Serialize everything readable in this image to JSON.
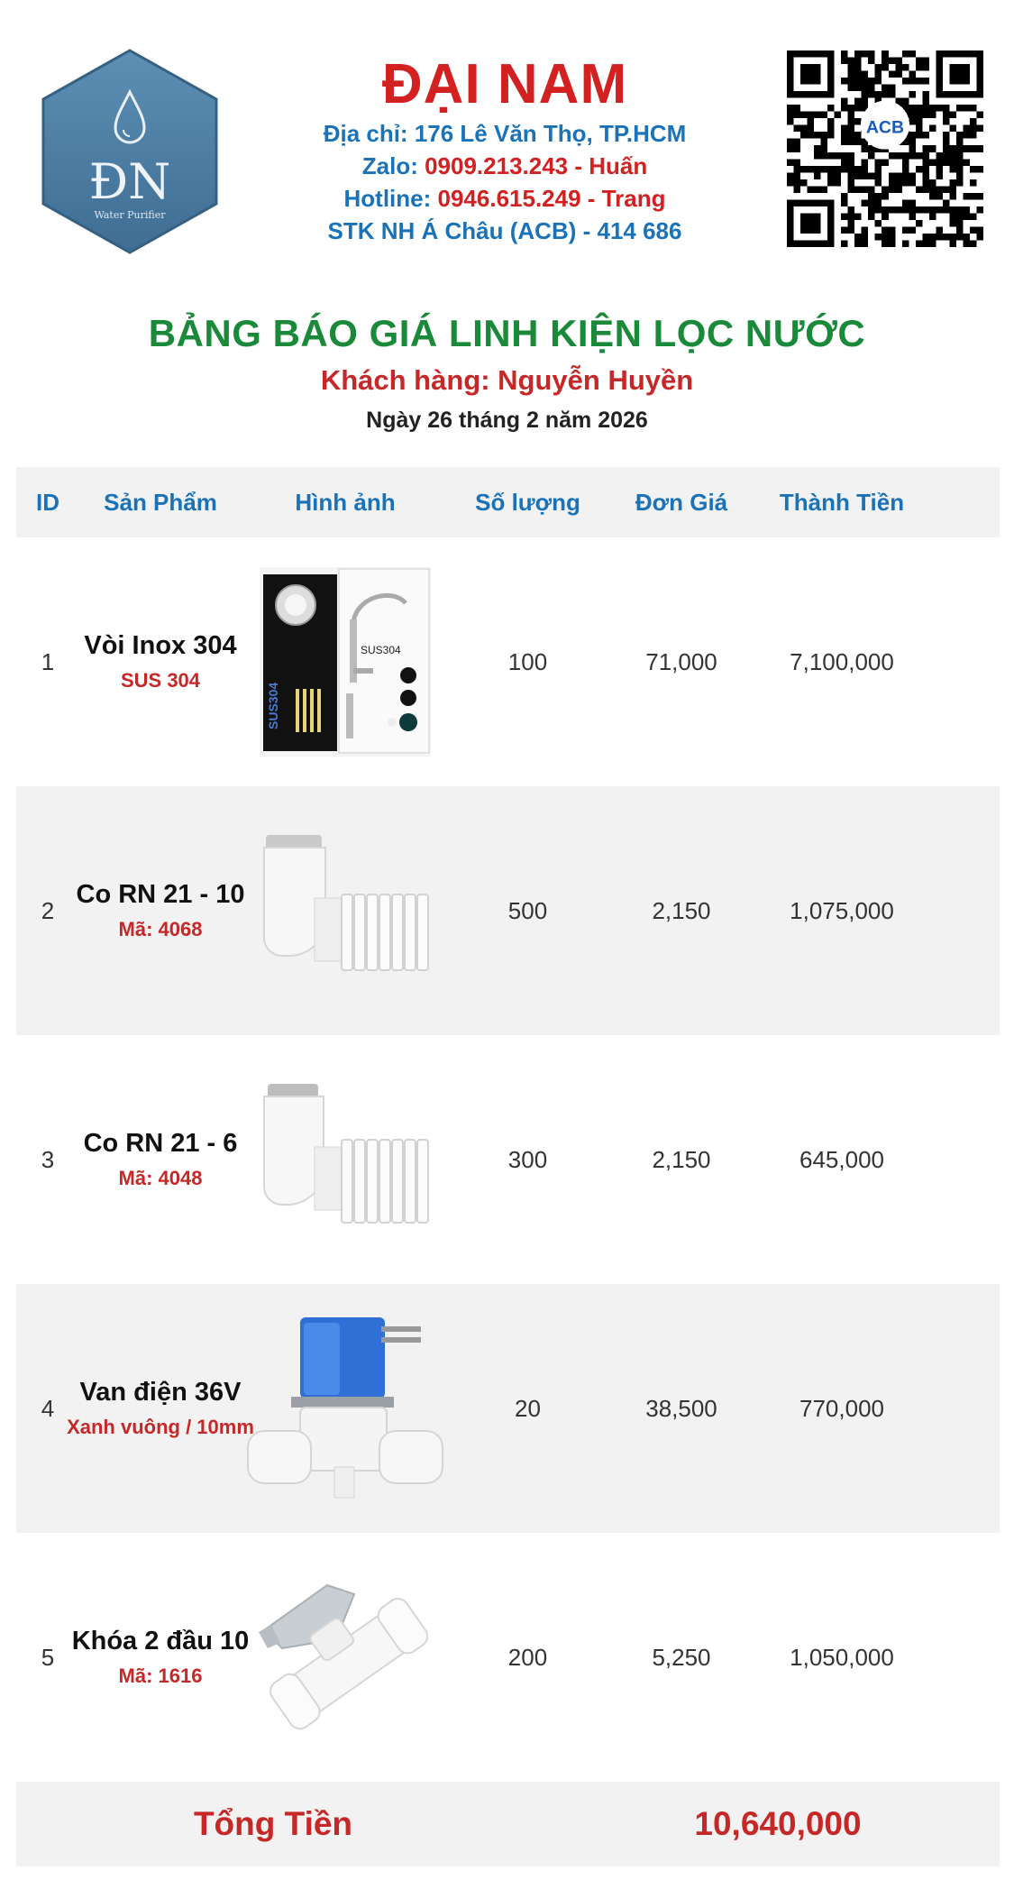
{
  "company": {
    "logo_text": "ĐN",
    "logo_subtext": "Water Purifier",
    "name": "ĐẠI NAM",
    "address_label": "Địa chỉ: 176 Lê Văn Thọ, TP.HCM",
    "zalo_label": "Zalo:",
    "zalo_value": "0909.213.243 - Huấn",
    "hotline_label": "Hotline:",
    "hotline_value": "0946.615.249 - Trang",
    "bank": "STK NH Á Châu (ACB) - 414 686",
    "qr_badge": "ACB"
  },
  "title": "BẢNG BÁO GIÁ LINH KIỆN LỌC NƯỚC",
  "customer": "Khách hàng: Nguyễn Huyền",
  "date": "Ngày 26 tháng 2 năm 2026",
  "table": {
    "headers": [
      "ID",
      "Sản Phẩm",
      "Hình ảnh",
      "Số lượng",
      "Đơn Giá",
      "Thành Tiền"
    ],
    "rows": [
      {
        "id": "1",
        "name": "Vòi Inox 304",
        "code": "SUS 304",
        "image": "faucet-box",
        "qty": "100",
        "price": "71,000",
        "total": "7,100,000"
      },
      {
        "id": "2",
        "name": "Co RN 21 - 10",
        "code": "Mã: 4068",
        "image": "elbow-fitting",
        "qty": "500",
        "price": "2,150",
        "total": "1,075,000"
      },
      {
        "id": "3",
        "name": "Co RN 21 - 6",
        "code": "Mã: 4048",
        "image": "elbow-fitting",
        "qty": "300",
        "price": "2,150",
        "total": "645,000"
      },
      {
        "id": "4",
        "name": "Van điện 36V",
        "code": "Xanh vuông / 10mm",
        "image": "solenoid-valve",
        "qty": "20",
        "price": "38,500",
        "total": "770,000"
      },
      {
        "id": "5",
        "name": "Khóa 2 đầu 10",
        "code": "Mã: 1616",
        "image": "ball-valve",
        "qty": "200",
        "price": "5,250",
        "total": "1,050,000"
      }
    ]
  },
  "footer": {
    "total_label": "Tổng Tiền",
    "total_value": "10,640,000"
  },
  "colors": {
    "brand_red": "#d32020",
    "info_blue": "#1a73b8",
    "title_green": "#1a8a3a",
    "row_alt": "#f2f2f2"
  }
}
